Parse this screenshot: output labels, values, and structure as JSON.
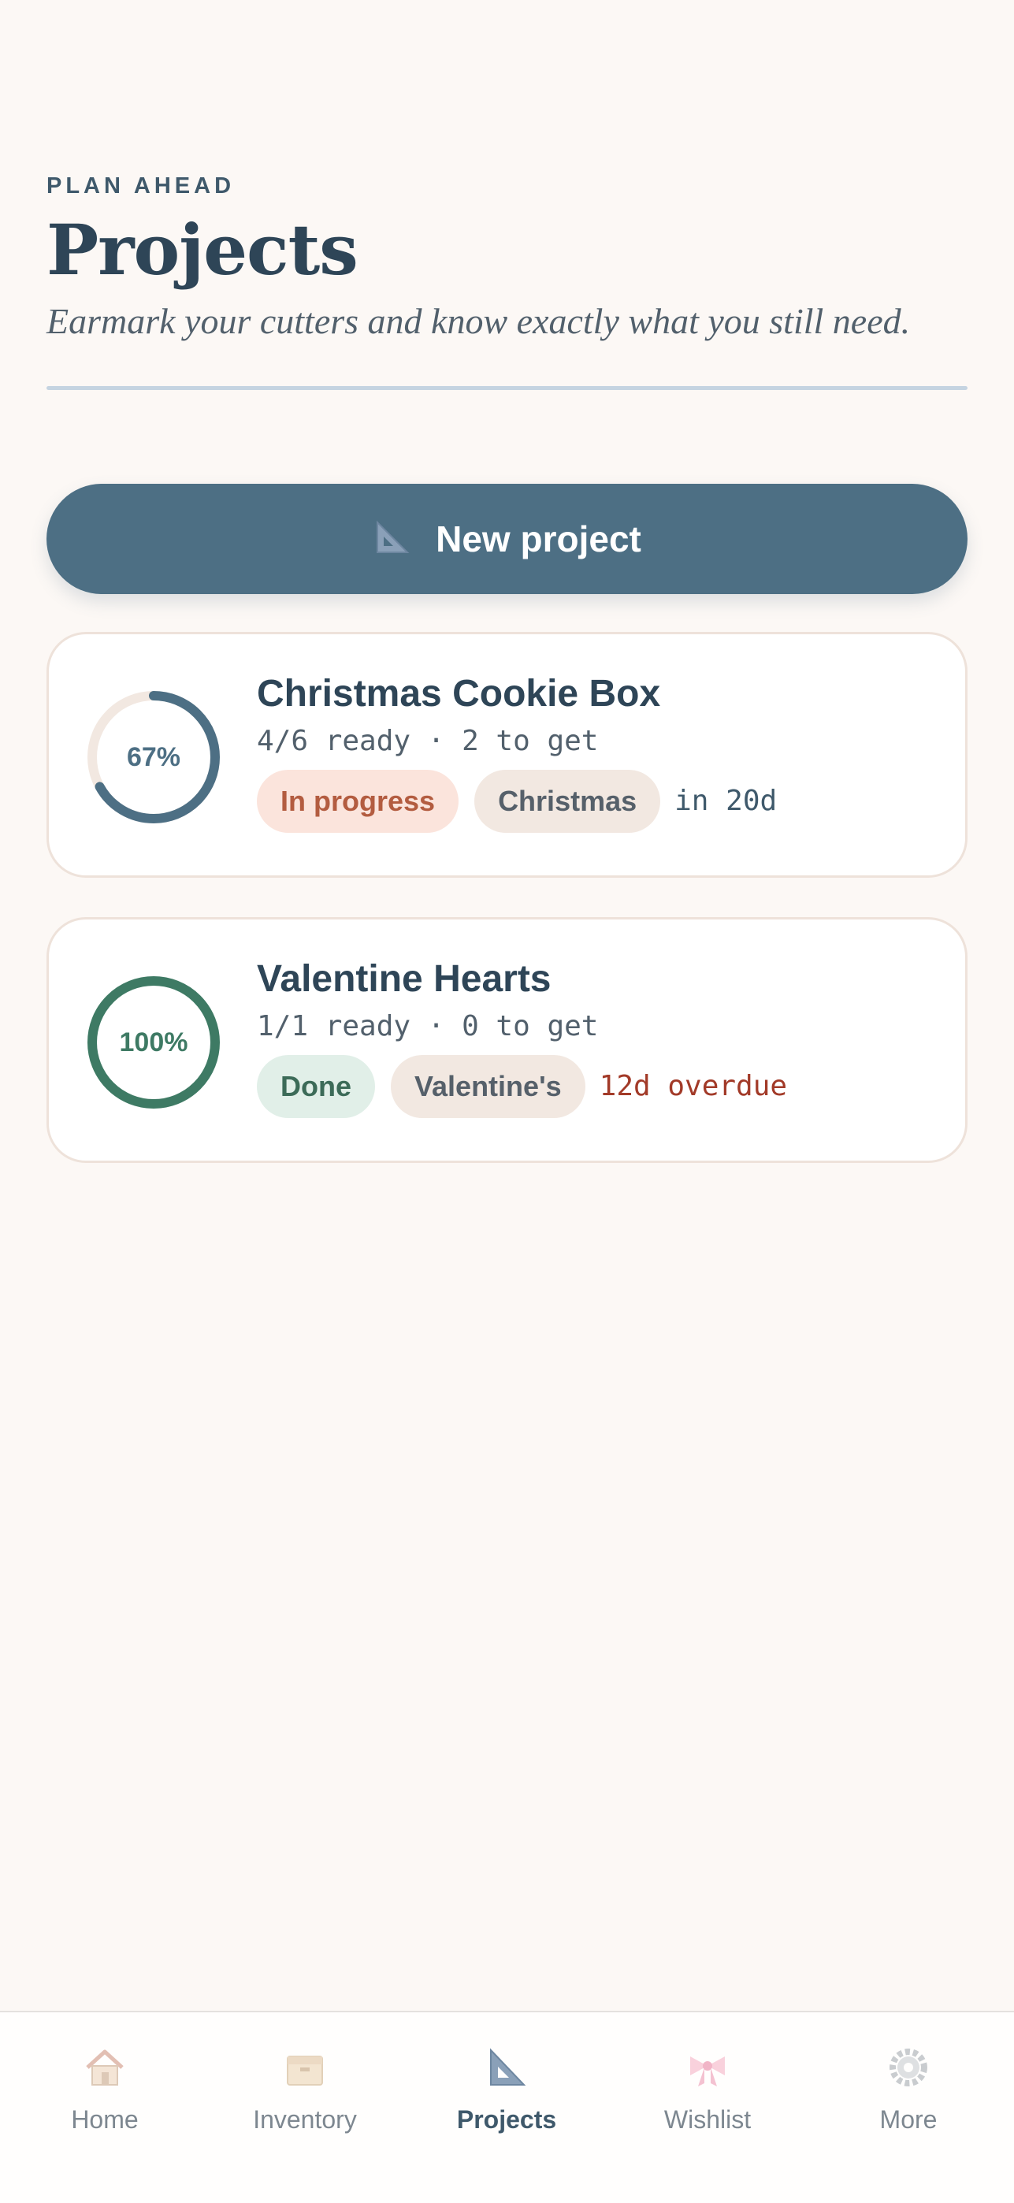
{
  "header": {
    "eyebrow": "PLAN AHEAD",
    "title": "Projects",
    "subtitle": "Earmark your cutters and know exactly what you still need."
  },
  "actions": {
    "new_project_label": "New project",
    "new_project_icon": "set-square-icon"
  },
  "projects": [
    {
      "title": "Christmas Cookie Box",
      "progress_percent": 67,
      "progress_label": "67%",
      "stats": "4/6 ready · 2 to get",
      "status": "In progress",
      "tag": "Christmas",
      "due": "in 20d",
      "accent_color": "#4d6f84"
    },
    {
      "title": "Valentine Hearts",
      "progress_percent": 100,
      "progress_label": "100%",
      "stats": "1/1 ready · 0 to get",
      "status": "Done",
      "tag": "Valentine's",
      "due": "12d overdue",
      "accent_color": "#3e7a64"
    }
  ],
  "nav": {
    "items": [
      {
        "label": "Home",
        "icon": "house-icon"
      },
      {
        "label": "Inventory",
        "icon": "box-icon"
      },
      {
        "label": "Projects",
        "icon": "set-square-icon",
        "active": true
      },
      {
        "label": "Wishlist",
        "icon": "bow-icon"
      },
      {
        "label": "More",
        "icon": "gear-icon"
      }
    ]
  },
  "colors": {
    "background": "#fcf8f5",
    "primary": "#4d6f84",
    "success": "#3e7a64",
    "overdue": "#a23a28"
  }
}
